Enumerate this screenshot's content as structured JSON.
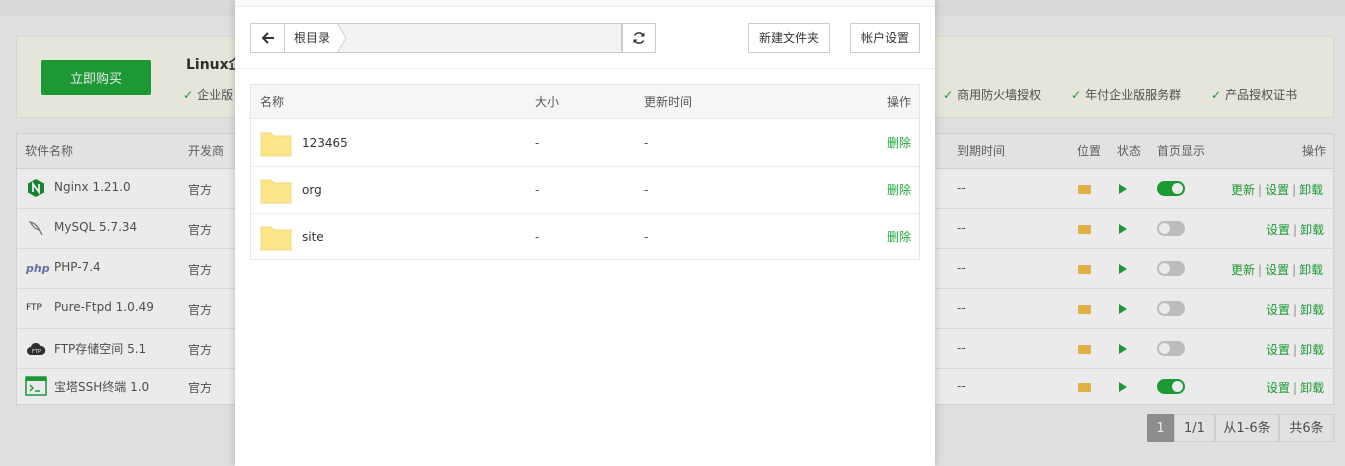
{
  "background": {
    "buy_button": "立即购买",
    "promo_title": "Linux企",
    "features": [
      "企业版",
      "商用防火墙授权",
      "年付企业版服务群",
      "产品授权证书"
    ],
    "headers": {
      "name": "软件名称",
      "developer": "开发商",
      "expire": "到期时间",
      "location": "位置",
      "status": "状态",
      "home_display": "首页显示",
      "actions": "操作"
    },
    "rows": [
      {
        "name": "Nginx 1.21.0",
        "developer": "官方",
        "expire": "--",
        "home_on": true,
        "actions": [
          "更新",
          "设置",
          "卸载"
        ],
        "icon": "nginx-icon"
      },
      {
        "name": "MySQL 5.7.34",
        "developer": "官方",
        "expire": "--",
        "home_on": false,
        "actions": [
          "设置",
          "卸载"
        ],
        "icon": "mysql-icon"
      },
      {
        "name": "PHP-7.4",
        "developer": "官方",
        "expire": "--",
        "home_on": false,
        "actions": [
          "更新",
          "设置",
          "卸载"
        ],
        "icon": "php-icon"
      },
      {
        "name": "Pure-Ftpd 1.0.49",
        "developer": "官方",
        "expire": "--",
        "home_on": false,
        "actions": [
          "设置",
          "卸载"
        ],
        "icon": "ftp-icon"
      },
      {
        "name": "FTP存储空间 5.1",
        "developer": "官方",
        "expire": "--",
        "home_on": false,
        "actions": [
          "设置",
          "卸载"
        ],
        "icon": "ftp-cloud-icon"
      },
      {
        "name": "宝塔SSH终端 1.0",
        "developer": "官方",
        "expire": "--",
        "home_on": true,
        "actions": [
          "设置",
          "卸载"
        ],
        "icon": "terminal-icon"
      }
    ],
    "pager": {
      "current": "1",
      "pages": "1/1",
      "range": "从1-6条",
      "total": "共6条"
    },
    "action_separator": "|",
    "php_badge": "php",
    "ftp_badge": "FTP"
  },
  "dialog": {
    "root_crumb": "根目录",
    "new_folder_button": "新建文件夹",
    "account_settings_button": "帐户设置",
    "columns": {
      "name": "名称",
      "size": "大小",
      "time": "更新时间",
      "actions": "操作"
    },
    "files": [
      {
        "name": "123465",
        "size": "-",
        "time": "-",
        "action": "删除"
      },
      {
        "name": "org",
        "size": "-",
        "time": "-",
        "action": "删除"
      },
      {
        "name": "site",
        "size": "-",
        "time": "-",
        "action": "删除"
      }
    ]
  },
  "colors": {
    "accent": "#20a53a",
    "folder": "#fde68a"
  }
}
